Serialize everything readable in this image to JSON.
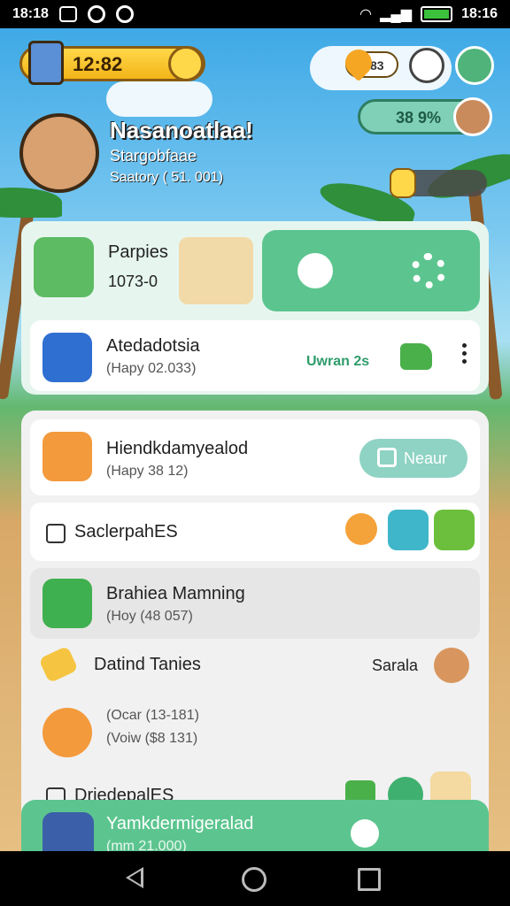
{
  "status_bar": {
    "time_left": "18:18",
    "time_right": "18:16"
  },
  "header": {
    "coins": "12:82",
    "hearts": "83",
    "percent": "38 9%"
  },
  "hero": {
    "title": "Nasanoatlaa!",
    "subtitle": "Stargobfaae",
    "meta": "Saatory ( 51. 001)"
  },
  "top_card": {
    "player_name": "Parpies",
    "player_score": "1073-0",
    "row": {
      "title": "Atedadotsia",
      "subtitle": "(Hapy 02.033)",
      "link": "Uwran 2s"
    }
  },
  "panel": {
    "row1": {
      "title": "Hiendkdamyealod",
      "subtitle": "(Hapy 38 12)",
      "button": "Neaur"
    },
    "row2": {
      "title": "SaclerpahES"
    },
    "row3": {
      "title": "Brahiea Mamning",
      "subtitle": "(Hoy (48 057)"
    },
    "row4": {
      "title": "Datind Tanies",
      "right_label": "Sarala",
      "sub1": "(Ocar (13-181)",
      "sub2": "(Voiw ($8 131)"
    },
    "row5": {
      "title": "DriedepalES"
    }
  },
  "bottom_bar": {
    "title": "Yamkdermigeralad",
    "subtitle": "(mm 21.000)"
  },
  "icons": {
    "nav_back": "back-triangle-icon",
    "nav_home": "home-circle-icon",
    "nav_recent": "recent-square-icon"
  },
  "colors": {
    "accent_green": "#5cc58f",
    "gold": "#ffd84a",
    "nav": "#000000"
  }
}
